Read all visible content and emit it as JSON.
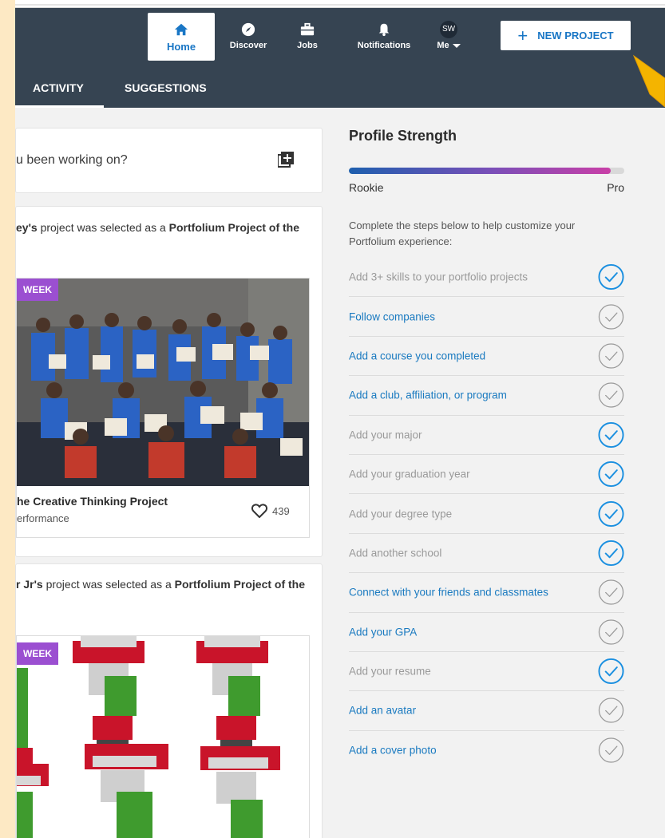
{
  "nav": {
    "items": [
      {
        "label": "Home",
        "icon": "home-icon",
        "active": true
      },
      {
        "label": "Discover",
        "icon": "compass-icon"
      },
      {
        "label": "Jobs",
        "icon": "briefcase-icon"
      },
      {
        "label": "Notifications",
        "icon": "bell-icon"
      }
    ],
    "me": {
      "initials": "SW",
      "label": "Me"
    },
    "new_project": "NEW PROJECT"
  },
  "tabs": [
    "ACTIVITY",
    "SUGGESTIONS"
  ],
  "composer": {
    "placeholder": "u been working on?"
  },
  "feed": [
    {
      "pre": "ey's",
      "mid": " project was selected as a ",
      "bold": "Portfolium Project of the",
      "badge": "WEEK",
      "title": "he Creative Thinking Project",
      "subtitle": "erformance",
      "likes": "439"
    },
    {
      "pre": "r Jr's",
      "mid": " project was selected as a ",
      "bold": "Portfolium Project of the",
      "badge": "WEEK"
    }
  ],
  "profile_strength": {
    "title": "Profile Strength",
    "low_label": "Rookie",
    "high_label": "Pro",
    "progress": 0.95,
    "intro": "Complete the steps below to help customize your Portfolium experience:",
    "steps": [
      {
        "label": "Add 3+ skills to your portfolio projects",
        "done": true
      },
      {
        "label": "Follow companies",
        "done": false
      },
      {
        "label": "Add a course you completed",
        "done": false
      },
      {
        "label": "Add a club, affiliation, or program",
        "done": false
      },
      {
        "label": "Add your major",
        "done": true
      },
      {
        "label": "Add your graduation year",
        "done": true
      },
      {
        "label": "Add your degree type",
        "done": true
      },
      {
        "label": "Add another school",
        "done": true
      },
      {
        "label": "Connect with your friends and classmates",
        "done": false
      },
      {
        "label": "Add your GPA",
        "done": false
      },
      {
        "label": "Add your resume",
        "done": true
      },
      {
        "label": "Add an avatar",
        "done": false
      },
      {
        "label": "Add a cover photo",
        "done": false
      }
    ]
  },
  "colors": {
    "nav_bg": "#364452",
    "accent": "#1976c5",
    "badge": "#9b4fd1",
    "check_done": "#1a8fe0",
    "check_todo": "#9a9a9a"
  }
}
